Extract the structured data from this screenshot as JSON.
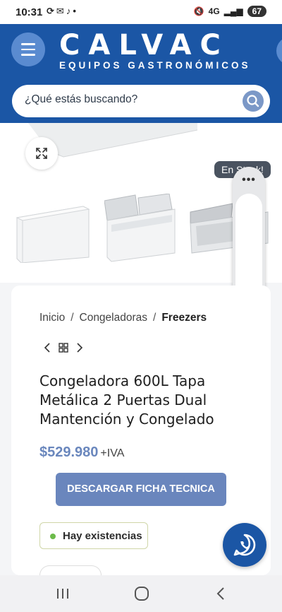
{
  "status_bar": {
    "time": "10:31",
    "notification_icons": [
      "sync-icon",
      "chat-icon",
      "tiktok-icon",
      "dot-icon"
    ],
    "network": "4G",
    "battery": "67"
  },
  "header": {
    "logo_main": "CALVAC",
    "logo_sub": "EQUIPOS GASTRONÓMICOS",
    "brand_color": "#1b56a5",
    "search": {
      "placeholder": "¿Qué estás buscando?"
    }
  },
  "gallery": {
    "stock_badge": "En Stock!"
  },
  "breadcrumb": {
    "items": [
      "Inicio",
      "Congeladoras"
    ],
    "current": "Freezers",
    "separator": "/"
  },
  "product": {
    "title": "Congeladora 600L Tapa Metálica 2 Puertas Dual Mantención y Congelado",
    "price": "$529.980",
    "tax_suffix": "+IVA",
    "download_label": "DESCARGAR FICHA TECNICA",
    "stock_status": "Hay existencias",
    "accent_color": "#6a86bd"
  },
  "floating_pill": {
    "menu_icon": "more-dots-icon",
    "bottom_icon": "read-aloud-icon"
  },
  "nav_bar": {
    "items": [
      "recents-icon",
      "home-icon",
      "back-icon"
    ]
  }
}
